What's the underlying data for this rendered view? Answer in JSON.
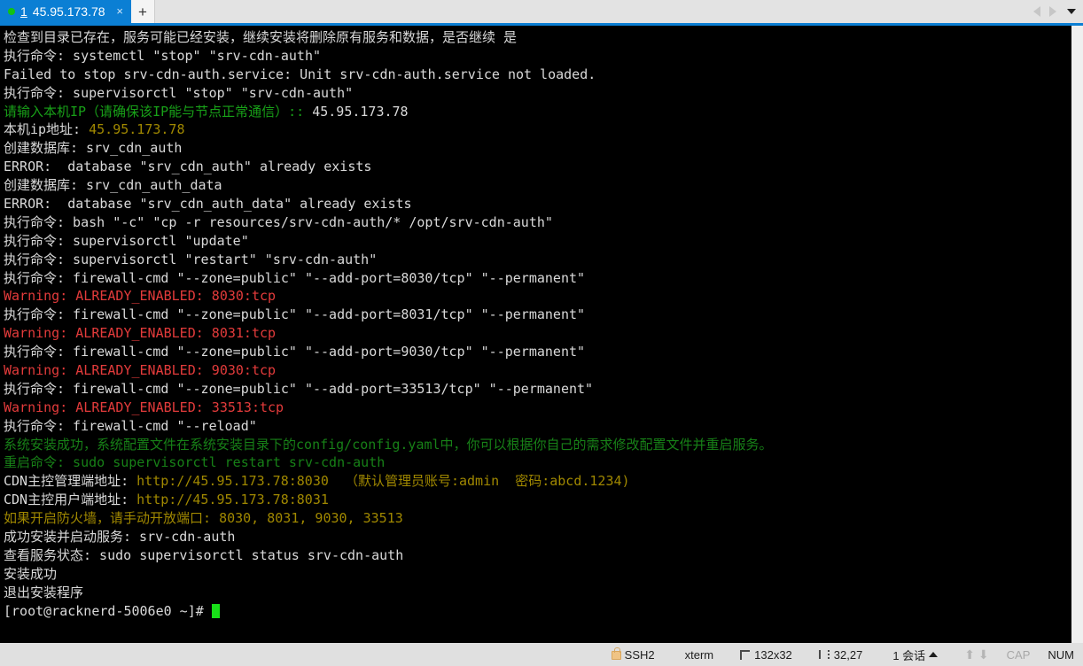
{
  "tabbar": {
    "tab_index": "1",
    "tab_title": "45.95.173.78",
    "close_label": "×",
    "new_tab_label": "+",
    "status_dot": "connected"
  },
  "terminal": {
    "lines": [
      [
        {
          "t": "检查到目录已存在，服务可能已经安装，继续安装将删除原有服务和数据，是否继续 是",
          "c": "w"
        }
      ],
      [
        {
          "t": "执行命令: systemctl \"stop\" \"srv-cdn-auth\"",
          "c": "w"
        }
      ],
      [
        {
          "t": "Failed to stop srv-cdn-auth.service: Unit srv-cdn-auth.service not loaded.",
          "c": "w"
        }
      ],
      [
        {
          "t": "执行命令: supervisorctl \"stop\" \"srv-cdn-auth\"",
          "c": "w"
        }
      ],
      [
        {
          "t": "请输入本机IP（请确保该IP能与节点正常通信）:: ",
          "c": "g"
        },
        {
          "t": "45.95.173.78",
          "c": "w"
        }
      ],
      [
        {
          "t": "本机ip地址: ",
          "c": "w"
        },
        {
          "t": "45.95.173.78",
          "c": "y"
        }
      ],
      [
        {
          "t": "创建数据库: srv_cdn_auth",
          "c": "w"
        }
      ],
      [
        {
          "t": "ERROR:  database \"srv_cdn_auth\" already exists",
          "c": "w"
        }
      ],
      [
        {
          "t": "创建数据库: srv_cdn_auth_data",
          "c": "w"
        }
      ],
      [
        {
          "t": "ERROR:  database \"srv_cdn_auth_data\" already exists",
          "c": "w"
        }
      ],
      [
        {
          "t": "执行命令: bash \"-c\" \"cp -r resources/srv-cdn-auth/* /opt/srv-cdn-auth\"",
          "c": "w"
        }
      ],
      [
        {
          "t": "执行命令: supervisorctl \"update\"",
          "c": "w"
        }
      ],
      [
        {
          "t": "执行命令: supervisorctl \"restart\" \"srv-cdn-auth\"",
          "c": "w"
        }
      ],
      [
        {
          "t": "执行命令: firewall-cmd \"--zone=public\" \"--add-port=8030/tcp\" \"--permanent\"",
          "c": "w"
        }
      ],
      [
        {
          "t": "Warning: ALREADY_ENABLED: 8030:tcp",
          "c": "r"
        }
      ],
      [
        {
          "t": "执行命令: firewall-cmd \"--zone=public\" \"--add-port=8031/tcp\" \"--permanent\"",
          "c": "w"
        }
      ],
      [
        {
          "t": "Warning: ALREADY_ENABLED: 8031:tcp",
          "c": "r"
        }
      ],
      [
        {
          "t": "执行命令: firewall-cmd \"--zone=public\" \"--add-port=9030/tcp\" \"--permanent\"",
          "c": "w"
        }
      ],
      [
        {
          "t": "Warning: ALREADY_ENABLED: 9030:tcp",
          "c": "r"
        }
      ],
      [
        {
          "t": "执行命令: firewall-cmd \"--zone=public\" \"--add-port=33513/tcp\" \"--permanent\"",
          "c": "w"
        }
      ],
      [
        {
          "t": "Warning: ALREADY_ENABLED: 33513:tcp",
          "c": "r"
        }
      ],
      [
        {
          "t": "执行命令: firewall-cmd \"--reload\"",
          "c": "w"
        }
      ],
      [
        {
          "t": "系统安装成功，系统配置文件在系统安装目录下的config/config.yaml中，你可以根据你自己的需求修改配置文件并重启服务。",
          "c": "gd"
        }
      ],
      [
        {
          "t": "重启命令: sudo supervisorctl restart srv-cdn-auth",
          "c": "gd"
        }
      ],
      [
        {
          "t": "CDN主控管理端地址: ",
          "c": "w"
        },
        {
          "t": "http://45.95.173.78:8030",
          "c": "y"
        },
        {
          "t": "  （默认管理员账号:admin  密码:abcd.1234)",
          "c": "y"
        }
      ],
      [
        {
          "t": "CDN主控用户端地址: ",
          "c": "w"
        },
        {
          "t": "http://45.95.173.78:8031",
          "c": "y"
        }
      ],
      [
        {
          "t": "如果开启防火墙，请手动开放端口: 8030, 8031, 9030, 33513",
          "c": "y"
        }
      ],
      [
        {
          "t": "成功安装并启动服务: srv-cdn-auth",
          "c": "w"
        }
      ],
      [
        {
          "t": "查看服务状态: sudo supervisorctl status srv-cdn-auth",
          "c": "w"
        }
      ],
      [
        {
          "t": "安装成功",
          "c": "w"
        }
      ],
      [
        {
          "t": "退出安装程序",
          "c": "w"
        }
      ]
    ],
    "prompt": "[root@racknerd-5006e0 ~]# ",
    "prompt_color": "w"
  },
  "statusbar": {
    "protocol": "SSH2",
    "emulation": "xterm",
    "size": "132x32",
    "cursor_position": "32,27",
    "sessions": "1 会话",
    "cap_label": "CAP",
    "num_label": "NUM"
  },
  "colors": {
    "accent_blue": "#0b7fd4",
    "terminal_bg": "#000000",
    "text_white": "#d9d9d9",
    "text_green": "#18a018",
    "text_dark_green": "#178017",
    "text_yellow": "#a08800",
    "text_red": "#e33b3b",
    "cursor_green": "#18e018",
    "chrome_gray": "#e0e0e0"
  }
}
